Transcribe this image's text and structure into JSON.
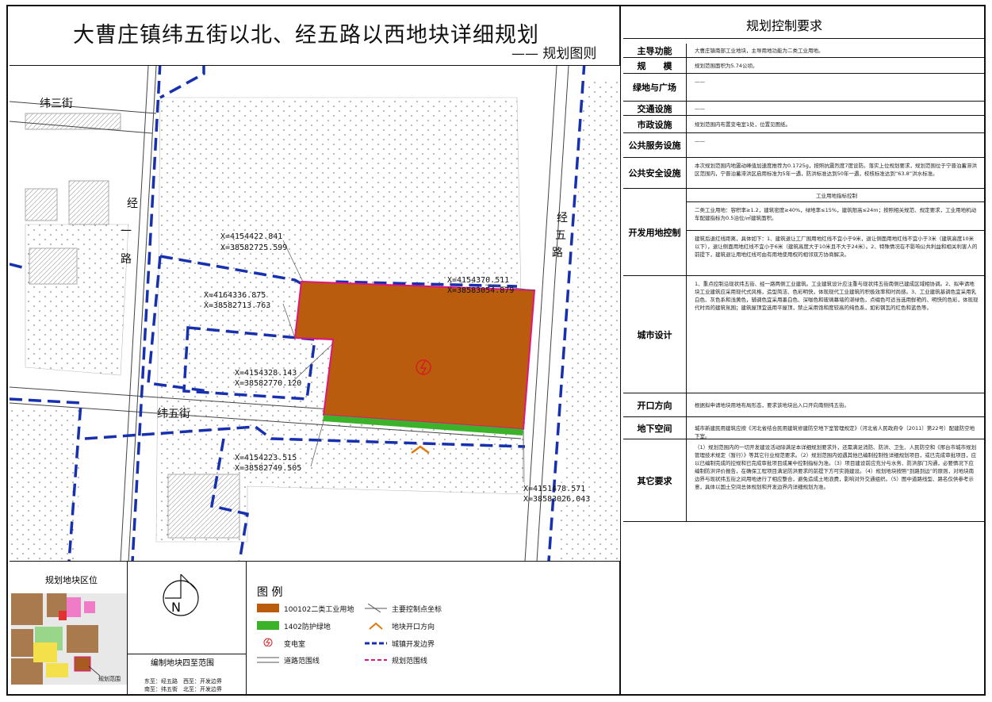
{
  "title": "大曹庄镇纬五街以北、经五路以西地块详细规划",
  "subtitle": "—— 规划图则",
  "map": {
    "road_labels": [
      "纬三街",
      "经一路",
      "经五路",
      "纬五街"
    ],
    "coords": [
      {
        "x": "X=4154422.841",
        "y": "X=38582725.599"
      },
      {
        "x": "X=4164336.875",
        "y": "X=38582713.763"
      },
      {
        "x": "X=4154370.511",
        "y": "X=38583054.879"
      },
      {
        "x": "X=4154328.143",
        "y": "X=38582770.120"
      },
      {
        "x": "X=4154223.515",
        "y": "X=38582749.505"
      },
      {
        "x": "X=4151478.571",
        "y": "X=38583026.043"
      }
    ]
  },
  "location": {
    "title": "规划地块区位",
    "range_label": "规划范围",
    "scope_title": "编制地块四至范围",
    "scope_lines": [
      "东至：经五路　西至：开发边界",
      "南至：纬五街　北至：开发边界"
    ]
  },
  "compass": {
    "north": "N"
  },
  "legend": {
    "title": "图 例",
    "items": [
      {
        "label": "100102二类工业用地",
        "color": "#b95c0e"
      },
      {
        "label": "主要控制点坐标",
        "icon": "control-point"
      },
      {
        "label": "1402防护绿地",
        "color": "#3cb22a"
      },
      {
        "label": "地块开口方向",
        "icon": "opening-arrow"
      },
      {
        "label": "变电室",
        "icon": "substation"
      },
      {
        "label": "城镇开发边界",
        "icon": "boundary-line"
      },
      {
        "label": "道路范围线",
        "icon": "road-line"
      },
      {
        "label": "规划范围线",
        "icon": "plan-line"
      }
    ]
  },
  "requirements": {
    "title": "规划控制要求",
    "rows": [
      {
        "label": "主导功能",
        "text": "大曹庄镇南部工业地块，主导用地功能为二类工业用地。"
      },
      {
        "label": "规　　模",
        "text": "规划范围面积为5.74公顷。"
      },
      {
        "label": "绿地与广场",
        "text": "——"
      },
      {
        "label": "交通设施",
        "text": "——"
      },
      {
        "label": "市政设施",
        "text": "规划范围内布置变电室1处，位置见图纸。"
      },
      {
        "label": "公共服务设施",
        "text": "——"
      },
      {
        "label": "公共安全设施",
        "text": "本次规划范围内地震动峰值加速度推荐为0.1725g，按照抗震烈度7度设防。落实上位规划要求，规划范围位于宁晋泊蓄滞洪区范围内，宁晋泊蓄滞洪区启用标准为5年一遇，防洪标准达到50年一遇，校核标准达到“63.8”洪水标准。"
      },
      {
        "label": "开发用地控制",
        "subheader": "工业用地指标控制",
        "text": "二类工业用地：容积率≥1.2，建筑密度≥40%，绿地率≤15%，建筑限高≤24m；按照相关规范、规定要求，工业用地机动车配建指标为0.5泊位/㎡建筑面积。",
        "text2": "建筑后退红线距离，具体如下：1、建筑退让工厂围用地红线不宜小于9米，退让侧面用地红线不宜小于3米（建筑高度10米以下），退让侧面用地红线不宜小于6米（建筑高度大于10米且不大于24米）。2、特殊情况在不影响公共利益和相关利害人的前提下，建筑退让用地红线可由有用地使用权的相邻双方协商解决。"
      },
      {
        "label": "城市设计",
        "text": "1、重点控制沿现状纬五街、经一路两侧工业建筑。工业建筑设计应注重与现状纬五街南侧已建成区域相协调。2、拟申请地块工业建筑应采用现代式风格，造型简洁、色彩明快，体现现代工业建筑的积极效率和时尚感。3、工业建筑基调色宜采用乳白色、灰色系和浅黄色，辅调色宜采用墨白色、深咖色和玻璃幕墙的湛绿色，点缀色可适当选用鲜艳的、明快的色彩，体现现代时尚的建筑氛围；建筑屋顶宜选用平屋顶，禁止采用饱和度较高的纯色系，如彩钢瓦的红色和蓝色等。"
      },
      {
        "label": "开口方向",
        "text": "根据拟申请地块用地布局形态，要求该地块出入口开向南侧纬五街。"
      },
      {
        "label": "地下空间",
        "text": "城市新建民用建筑应按《河北省结合民用建筑修建防空地下室管理规定》（河北省人民政府令〔2011〕第22号）配建防空地下室。"
      },
      {
        "label": "其它要求",
        "text": "（1）规划范围内的一切开发建设活动除满足本详细规划要求外，还需满足消防、防洪、卫生、人民防空和《邢台市城市规划管理技术规定（暂行）》等其它行业规范要求。（2）规划范围内如遇其他已编制控制性详细规划项目，或已完成审批项目，应以已编制完成的控规和已完成审批项目成果中控制指标为准。（3）项目建设前应充分与水务、防洪部门沟通，必要情况下应编制防洪评价报告，在确保工程项目满足防洪要求的前提下方可实施建设。（4）规划地块按照“到路到边”的原则，对地块南边界与现状纬五街之间用地进行了相应整合，避免造成土地浪费，影响对外交通组织。（5）图中道路线型、路名仅供参考示意，具体以国土空间总体规划和开发边界内详细规划为准。"
      }
    ]
  },
  "colors": {
    "industrial": "#b95c0e",
    "green": "#3cb22a",
    "boundary": "#1730b0",
    "plan": "#e0157f"
  }
}
